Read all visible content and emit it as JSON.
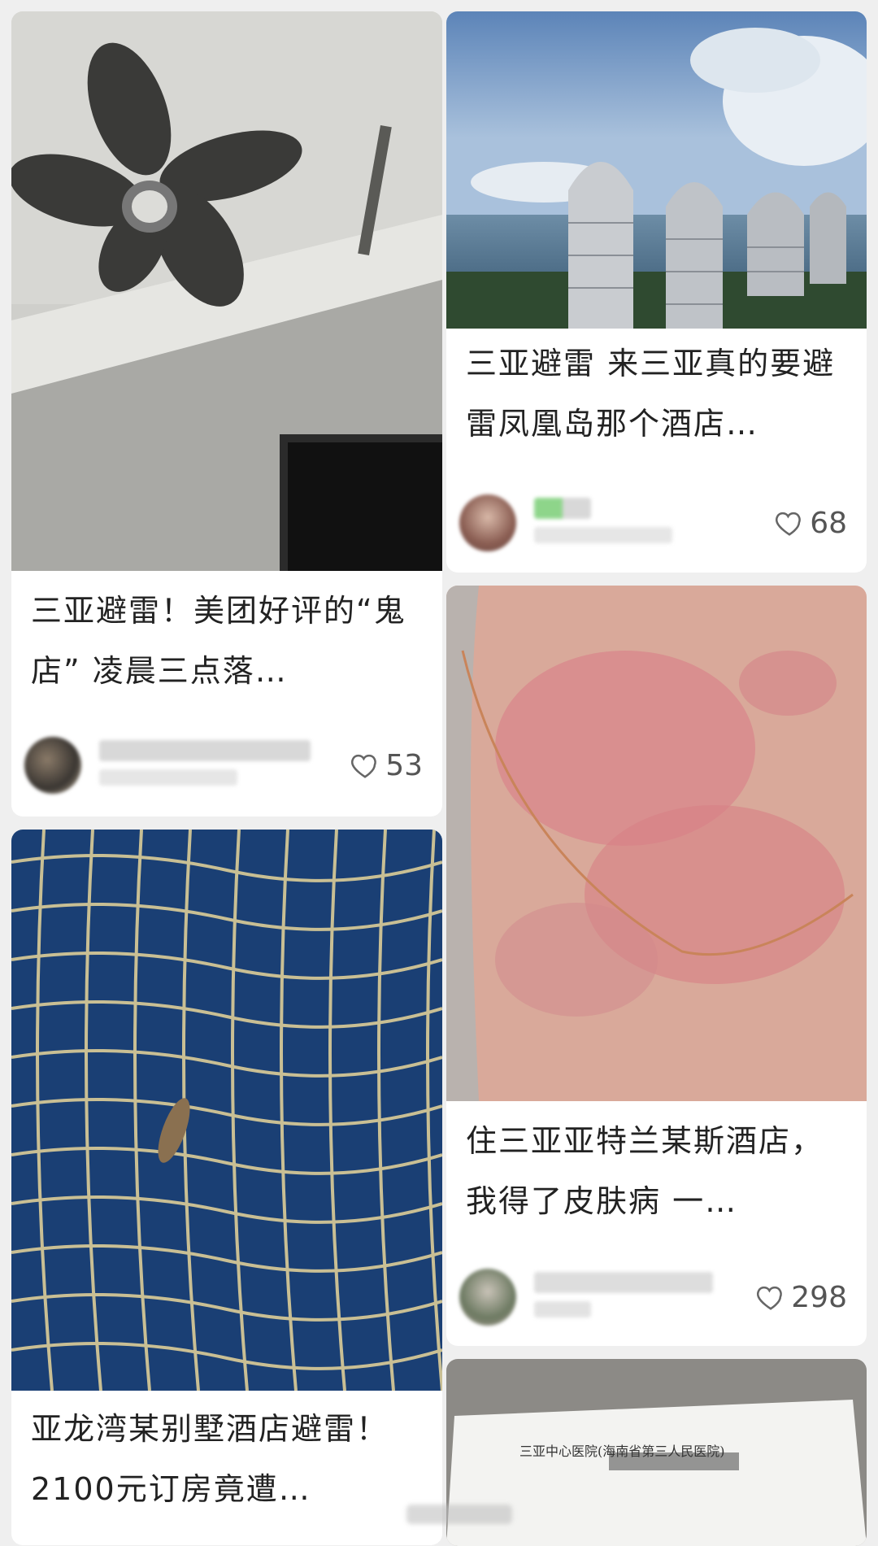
{
  "feed": {
    "cards": [
      {
        "image_description": "ceiling fan on hotel room ceiling",
        "title": "三亚避雷！美团好评的“鬼店” 凌晨三点落…",
        "likes": "53",
        "heart_icon": "heart-outline-icon"
      },
      {
        "image_description": "Phoenix Island towers by the sea",
        "title": "三亚避雷 来三亚真的要避雷凤凰岛那个酒店…",
        "likes": "68",
        "heart_icon": "heart-outline-icon"
      },
      {
        "image_description": "skin rash on neck with gold chain",
        "title": "住三亚亚特兰某斯酒店，我得了皮肤病 一…",
        "likes": "298",
        "heart_icon": "heart-outline-icon"
      },
      {
        "image_description": "insect in blue tiled swimming pool",
        "title": "亚龙湾某别墅酒店避雷！2100元订房竟遭…",
        "likes": "",
        "heart_icon": "heart-outline-icon"
      },
      {
        "image_description": "hospital document paper",
        "document_header": "三亚中心医院(海南省第三人民医院)",
        "title": "",
        "likes": ""
      }
    ]
  },
  "colors": {
    "background": "#efefef",
    "card": "#ffffff",
    "text": "#222222",
    "meta": "#555555"
  }
}
